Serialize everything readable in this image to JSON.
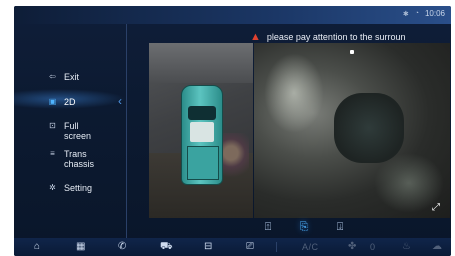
{
  "status": {
    "time": "10:06",
    "icons": [
      "bluetooth-icon",
      "wifi-icon"
    ]
  },
  "warning": {
    "text": "please pay attention to the surroun",
    "icon": "warning-triangle-icon"
  },
  "sidebar": {
    "items": [
      {
        "label": "Exit",
        "icon": "exit-icon"
      },
      {
        "label": "2D",
        "icon": "2d-view-icon",
        "active": true
      },
      {
        "label": "Full\nscreen",
        "line1": "Full",
        "line2": "screen",
        "icon": "fullscreen-icon"
      },
      {
        "label": "Trans\nchassis",
        "line1": "Trans",
        "line2": "chassis",
        "icon": "chassis-icon"
      },
      {
        "label": "Setting",
        "icon": "gear-icon"
      }
    ]
  },
  "camera_views": [
    "front-camera-icon",
    "side-camera-icon",
    "rear-camera-icon"
  ],
  "bottombar": {
    "items": [
      "home-icon",
      "apps-grid-icon",
      "phone-icon",
      "car-icon",
      "radio-icon",
      "phone-projection-icon"
    ],
    "ac_label": "A/C",
    "fan_level": "0",
    "colors": {
      "active": "#cfdcf0",
      "disabled": "#51607a"
    }
  },
  "colors": {
    "accent": "#4fb4ff",
    "warning": "#e0412f"
  }
}
